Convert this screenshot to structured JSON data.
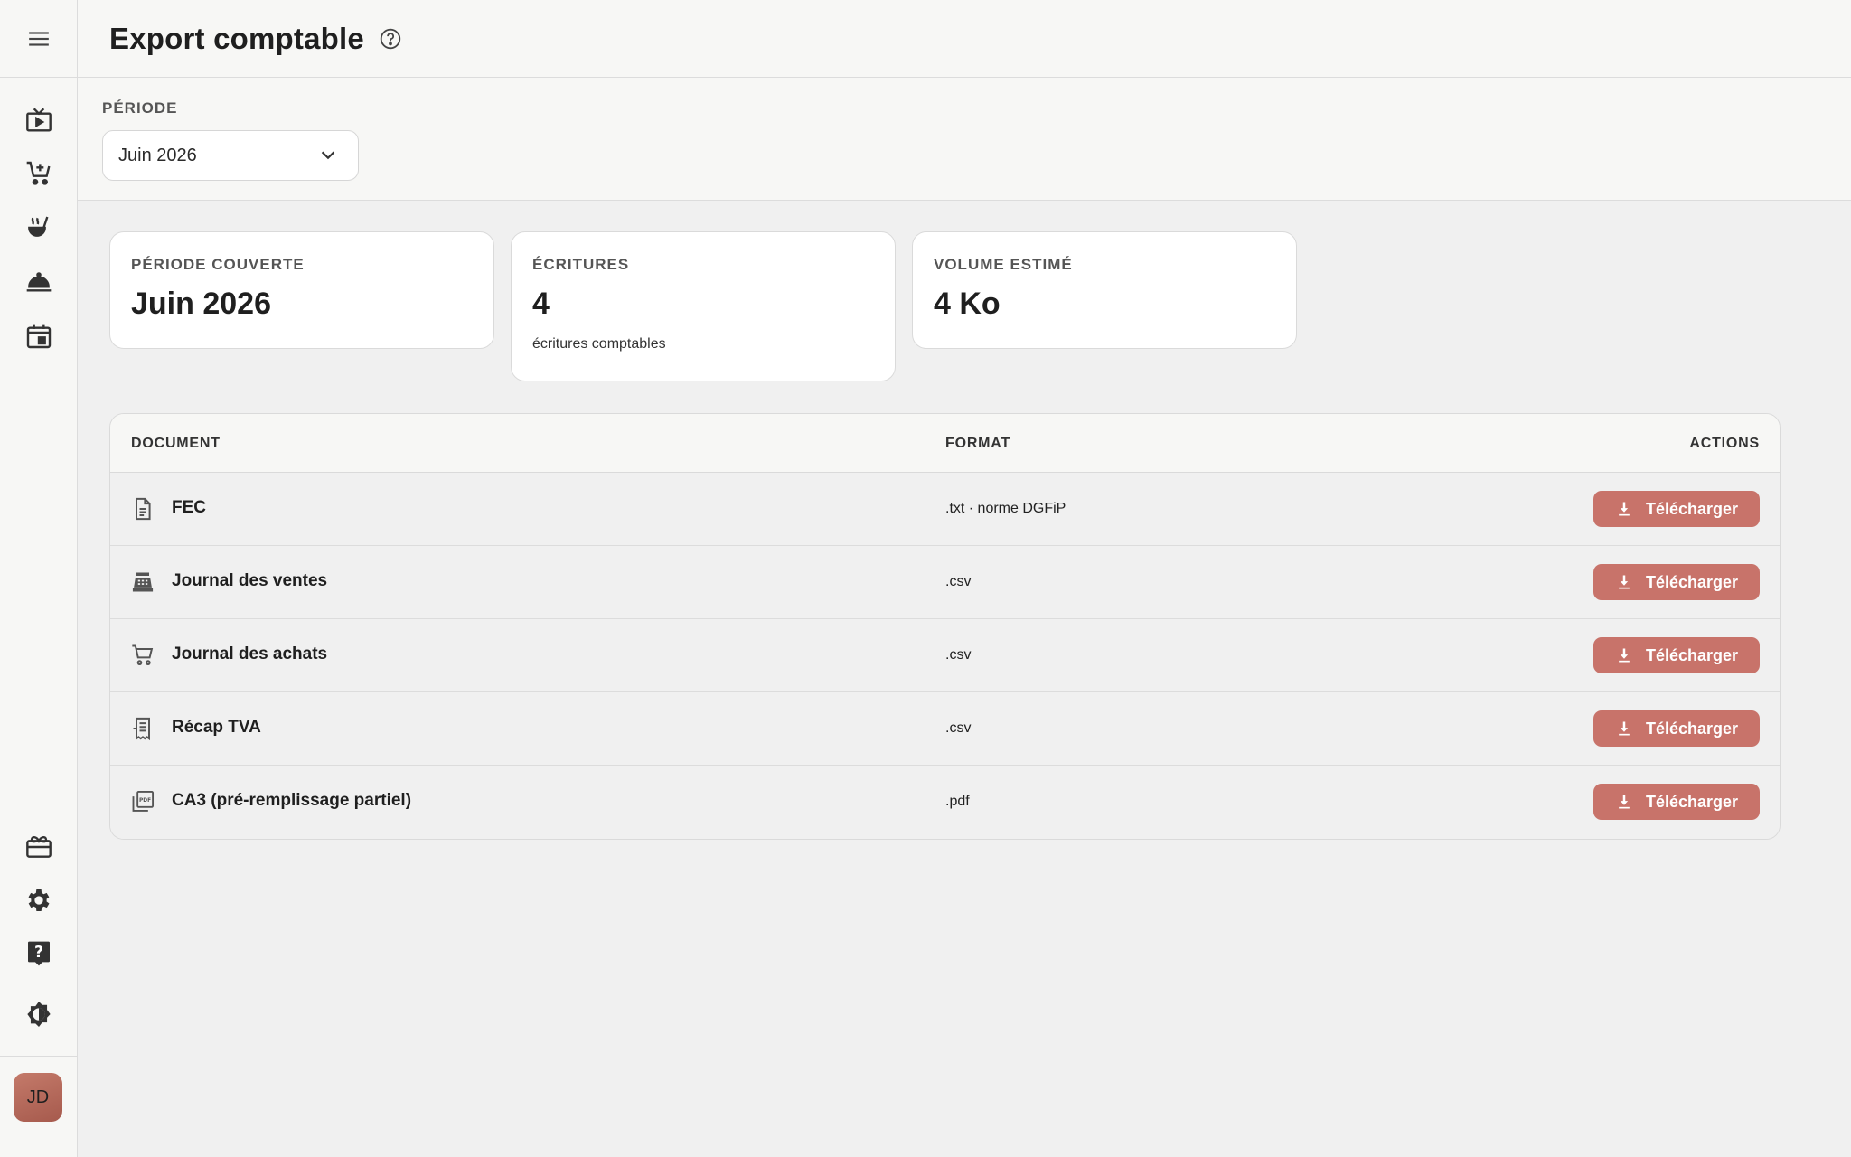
{
  "header": {
    "title": "Export comptable"
  },
  "filter": {
    "label": "PÉRIODE",
    "selected": "Juin 2026"
  },
  "cards": [
    {
      "label": "PÉRIODE COUVERTE",
      "value": "Juin 2026",
      "sub": ""
    },
    {
      "label": "ÉCRITURES",
      "value": "4",
      "sub": "écritures comptables"
    },
    {
      "label": "VOLUME ESTIMÉ",
      "value": "4 Ko",
      "sub": ""
    }
  ],
  "table": {
    "headers": {
      "document": "DOCUMENT",
      "format": "FORMAT",
      "actions": "ACTIONS"
    },
    "rows": [
      {
        "name": "FEC",
        "format": ".txt · norme DGFiP",
        "action": "Télécharger",
        "icon": "file-text-icon"
      },
      {
        "name": "Journal des ventes",
        "format": ".csv",
        "action": "Télécharger",
        "icon": "cash-register-icon"
      },
      {
        "name": "Journal des achats",
        "format": ".csv",
        "action": "Télécharger",
        "icon": "cart-icon"
      },
      {
        "name": "Récap TVA",
        "format": ".csv",
        "action": "Télécharger",
        "icon": "receipt-icon"
      },
      {
        "name": "CA3 (pré-remplissage partiel)",
        "format": ".pdf",
        "action": "Télécharger",
        "icon": "pdf-icon"
      }
    ]
  },
  "user": {
    "initials": "JD"
  },
  "colors": {
    "accent": "#c8736a",
    "background": "#f0f0f0",
    "panel": "#f7f7f5"
  }
}
